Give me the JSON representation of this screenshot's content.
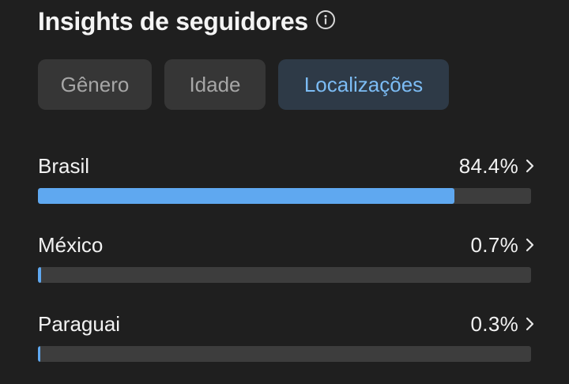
{
  "header": {
    "title": "Insights de seguidores",
    "info_icon": "info-circle-icon"
  },
  "tabs": [
    {
      "label": "Gênero",
      "active": false
    },
    {
      "label": "Idade",
      "active": false
    },
    {
      "label": "Localizações",
      "active": true
    }
  ],
  "locations": [
    {
      "country": "Brasil",
      "percent_label": "84.4%",
      "percent": 84.4
    },
    {
      "country": "México",
      "percent_label": "0.7%",
      "percent": 0.7
    },
    {
      "country": "Paraguai",
      "percent_label": "0.3%",
      "percent": 0.3
    }
  ],
  "colors": {
    "background": "#1f1f1f",
    "bar_fill": "#5fa8f0",
    "bar_track": "#3d3d3d",
    "active_tab_text": "#7cbcf4",
    "active_tab_bg": "#2e3a47"
  }
}
